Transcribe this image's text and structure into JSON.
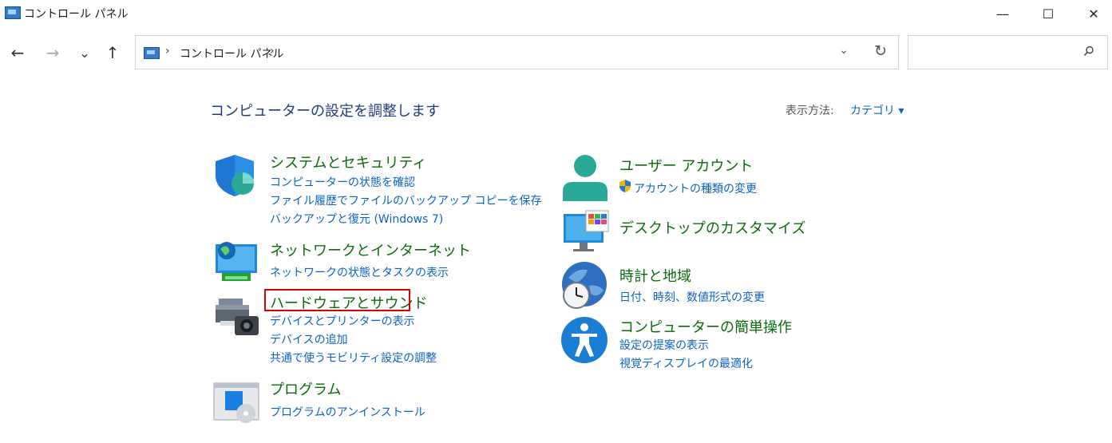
{
  "window": {
    "title": "コントロール パネル",
    "minimize": "—",
    "maximize": "☐",
    "close": "✕"
  },
  "nav": {
    "back": "←",
    "forward": "→",
    "recent": "⌄",
    "up": "↑"
  },
  "address": {
    "sep": "›",
    "crumb": "コントロール パネル",
    "dropdown": "⌄",
    "refresh": "↻"
  },
  "search": {
    "placeholder": "",
    "icon": "search-icon"
  },
  "main": {
    "heading": "コンピューターの設定を調整します",
    "view_by_label": "表示方法:",
    "view_by_value": "カテゴリ ▾"
  },
  "categories": {
    "system": {
      "title": "システムとセキュリティ",
      "links": [
        "コンピューターの状態を確認",
        "ファイル履歴でファイルのバックアップ コピーを保存",
        "バックアップと復元 (Windows 7)"
      ]
    },
    "network": {
      "title": "ネットワークとインターネット",
      "links": [
        "ネットワークの状態とタスクの表示"
      ]
    },
    "hardware": {
      "title": "ハードウェアとサウンド",
      "links": [
        "デバイスとプリンターの表示",
        "デバイスの追加",
        "共通で使うモビリティ設定の調整"
      ]
    },
    "programs": {
      "title": "プログラム",
      "links": [
        "プログラムのアンインストール"
      ]
    },
    "user": {
      "title": "ユーザー アカウント",
      "links": [
        "アカウントの種類の変更"
      ]
    },
    "desktop": {
      "title": "デスクトップのカスタマイズ",
      "links": []
    },
    "clock": {
      "title": "時計と地域",
      "links": [
        "日付、時刻、数値形式の変更"
      ]
    },
    "access": {
      "title": "コンピューターの簡単操作",
      "links": [
        "設定の提案の表示",
        "視覚ディスプレイの最適化"
      ]
    }
  },
  "colors": {
    "category_title": "#0b6a0b",
    "link": "#0b63c4",
    "highlight": "#e00000"
  }
}
